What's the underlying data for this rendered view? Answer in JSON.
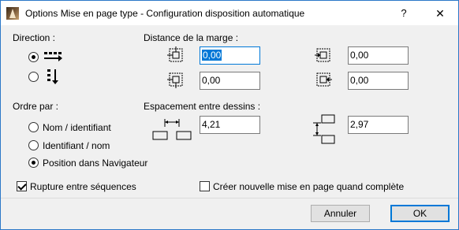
{
  "window": {
    "title": "Options Mise en page type  - Configuration disposition automatique",
    "help_label": "?",
    "close_label": "✕"
  },
  "direction": {
    "label": "Direction :",
    "options": [
      {
        "icon": "horizontal-arrange-icon",
        "selected": true
      },
      {
        "icon": "vertical-arrange-icon",
        "selected": false
      }
    ]
  },
  "margin": {
    "label": "Distance de la marge :",
    "top_left": "0,00",
    "top_right": "0,00",
    "bottom_left": "0,00",
    "bottom_right": "0,00"
  },
  "order": {
    "label": "Ordre par :",
    "options": [
      {
        "label": "Nom  / identifiant",
        "selected": false
      },
      {
        "label": "Identifiant / nom",
        "selected": false
      },
      {
        "label": "Position dans Navigateur",
        "selected": true
      }
    ]
  },
  "spacing": {
    "label": "Espacement entre dessins :",
    "horizontal": "4,21",
    "vertical": "2,97"
  },
  "checks": {
    "break_sequences": {
      "label": "Rupture entre séquences",
      "checked": true
    },
    "new_layout": {
      "label": "Créer nouvelle mise en page quand complète",
      "checked": false
    }
  },
  "buttons": {
    "cancel": "Annuler",
    "ok": "OK"
  },
  "colors": {
    "accent": "#0078d7",
    "window_border": "#2b78c8",
    "dialog_bg": "#f0f0f0"
  }
}
